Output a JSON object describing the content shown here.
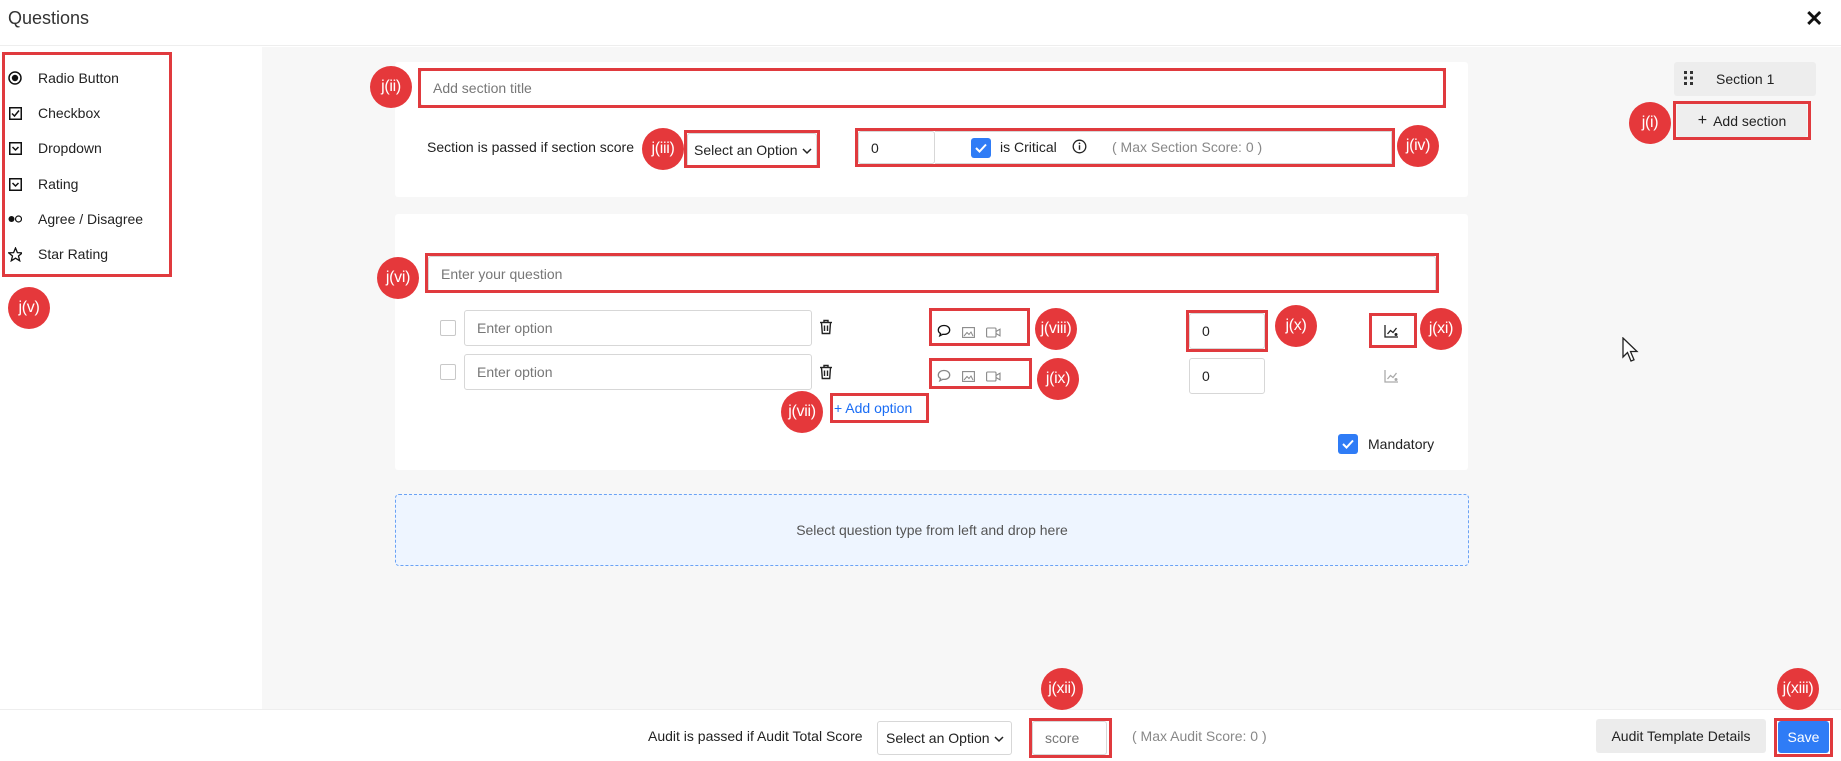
{
  "header": {
    "title": "Questions",
    "close_icon": "close-icon"
  },
  "question_types": [
    {
      "label": "Radio Button",
      "icon": "radio-icon"
    },
    {
      "label": "Checkbox",
      "icon": "checkbox-icon"
    },
    {
      "label": "Dropdown",
      "icon": "dropdown-icon"
    },
    {
      "label": "Rating",
      "icon": "rating-icon"
    },
    {
      "label": "Agree / Disagree",
      "icon": "toggle-icon"
    },
    {
      "label": "Star Rating",
      "icon": "star-icon"
    }
  ],
  "section": {
    "title_placeholder": "Add section title",
    "pass_label": "Section is passed if section score",
    "select_placeholder": "Select an Option",
    "score_value": "0",
    "critical_label": "is Critical",
    "max_score_text": "( Max Section Score: 0 )"
  },
  "sections_nav": {
    "section_label": "Section 1",
    "add_section_label": "Add section"
  },
  "question": {
    "placeholder": "Enter your question",
    "options": [
      {
        "placeholder": "Enter option",
        "score": "0"
      },
      {
        "placeholder": "Enter option",
        "score": "0"
      }
    ],
    "add_option_label": "+ Add option",
    "mandatory_label": "Mandatory"
  },
  "dropzone": {
    "text": "Select question type from left and drop here"
  },
  "footer": {
    "audit_pass_label": "Audit is passed if Audit Total Score",
    "select_placeholder": "Select an Option",
    "score_placeholder": "score",
    "max_audit_text": "( Max Audit Score: 0 )",
    "details_label": "Audit Template Details",
    "save_label": "Save"
  },
  "annotations": {
    "ji": "j(i)",
    "jii": "j(ii)",
    "jiii": "j(iii)",
    "jiv": "j(iv)",
    "jv": "j(v)",
    "jvi": "j(vi)",
    "jvii": "j(vii)",
    "jviii": "j(viii)",
    "jix": "j(ix)",
    "jx": "j(x)",
    "jxi": "j(xi)",
    "jxii": "j(xii)",
    "jxiii": "j(xiii)"
  },
  "colors": {
    "accent": "#2f7cf6",
    "annotation": "#e5383b",
    "link": "#1a6df5"
  }
}
